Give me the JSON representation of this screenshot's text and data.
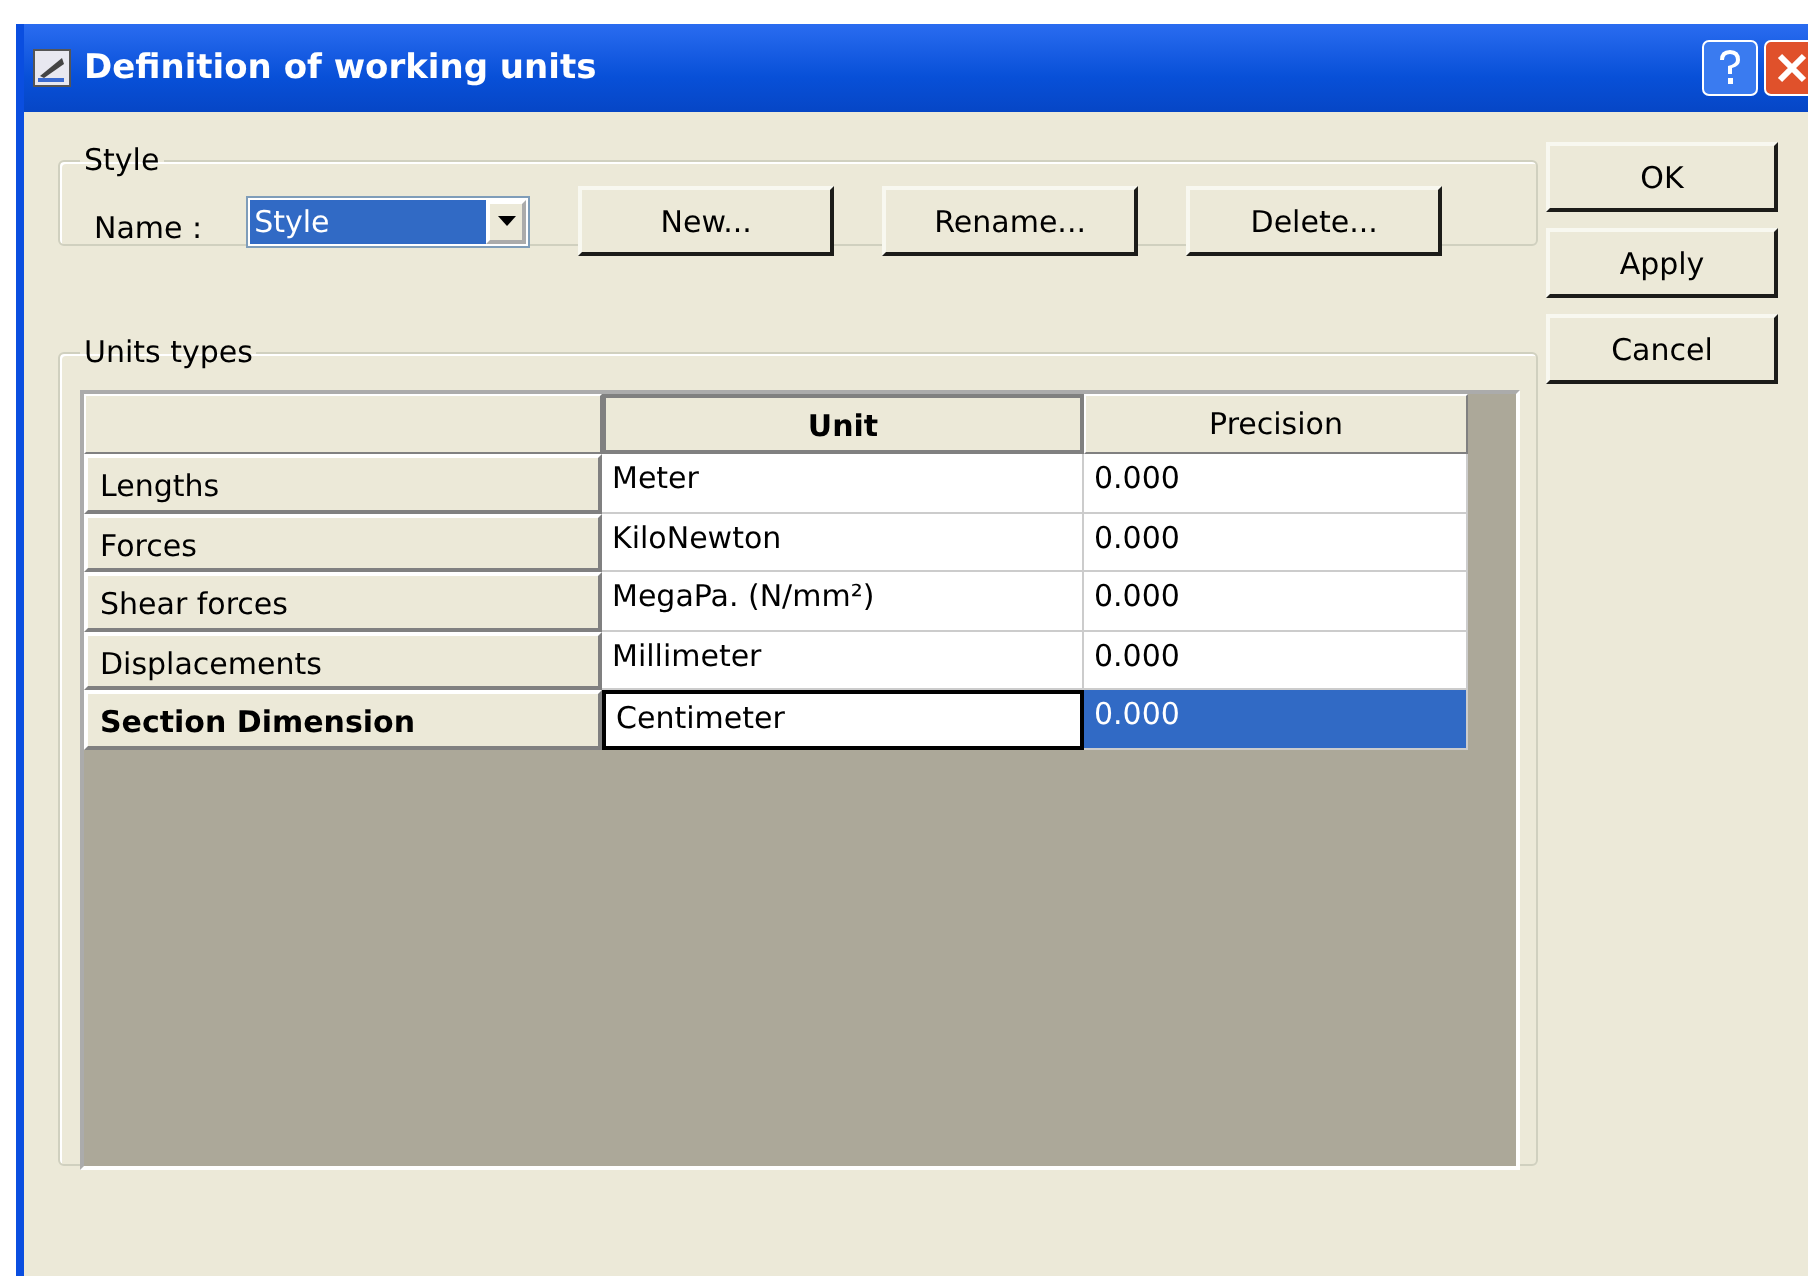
{
  "window": {
    "title": "Definition of working units"
  },
  "style_group": {
    "title": "Style",
    "name_label": "Name :",
    "name_value": "Style",
    "buttons": [
      "New...",
      "Rename...",
      "Delete..."
    ]
  },
  "dialog_buttons": [
    "OK",
    "Apply",
    "Cancel"
  ],
  "units_group": {
    "title": "Units types"
  },
  "table": {
    "columns": [
      {
        "label": "Unit",
        "selected": true
      },
      {
        "label": "Precision",
        "selected": false
      }
    ],
    "rows": [
      {
        "label": "Lengths",
        "unit": "Meter",
        "precision": "0.000",
        "selected": false
      },
      {
        "label": "Forces",
        "unit": "KiloNewton",
        "precision": "0.000",
        "selected": false
      },
      {
        "label": "Shear forces",
        "unit": "MegaPa. (N/mm²)",
        "precision": "0.000",
        "selected": false
      },
      {
        "label": "Displacements",
        "unit": "Millimeter",
        "precision": "0.000",
        "selected": false
      },
      {
        "label": "Section Dimension",
        "unit": "Centimeter",
        "precision": "0.000",
        "selected": true
      }
    ]
  }
}
